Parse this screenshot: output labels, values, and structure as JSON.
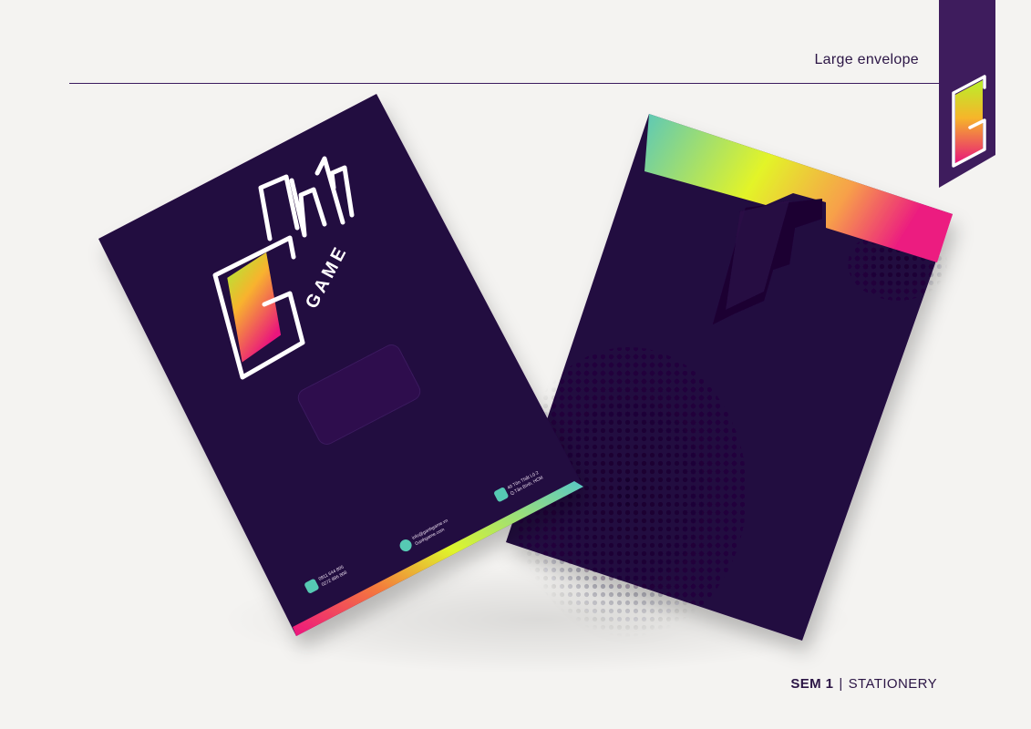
{
  "header": {
    "title": "Large envelope"
  },
  "brand": {
    "logo_text": "Gánh",
    "logo_sub": "GAME"
  },
  "envelope_front": {
    "contacts": [
      {
        "icon": "phone-icon",
        "lines": [
          "0911 644 805",
          "0272 896 808"
        ]
      },
      {
        "icon": "globe-icon",
        "lines": [
          "info@ganhgame.vn",
          "Ganhgame.com"
        ]
      },
      {
        "icon": "location-pin-icon",
        "lines": [
          "40 Tôn Thất Lộ 2",
          "Q.Tân Bình, HCM"
        ]
      }
    ]
  },
  "footer": {
    "section": "SEM 1",
    "separator": "|",
    "label": "STATIONERY"
  },
  "colors": {
    "envelope": "#24073f",
    "accent_pink": "#e5147a",
    "accent_yellow": "#e2f52a",
    "accent_teal": "#57c9b3",
    "brand_purple": "#3e1c5d"
  }
}
